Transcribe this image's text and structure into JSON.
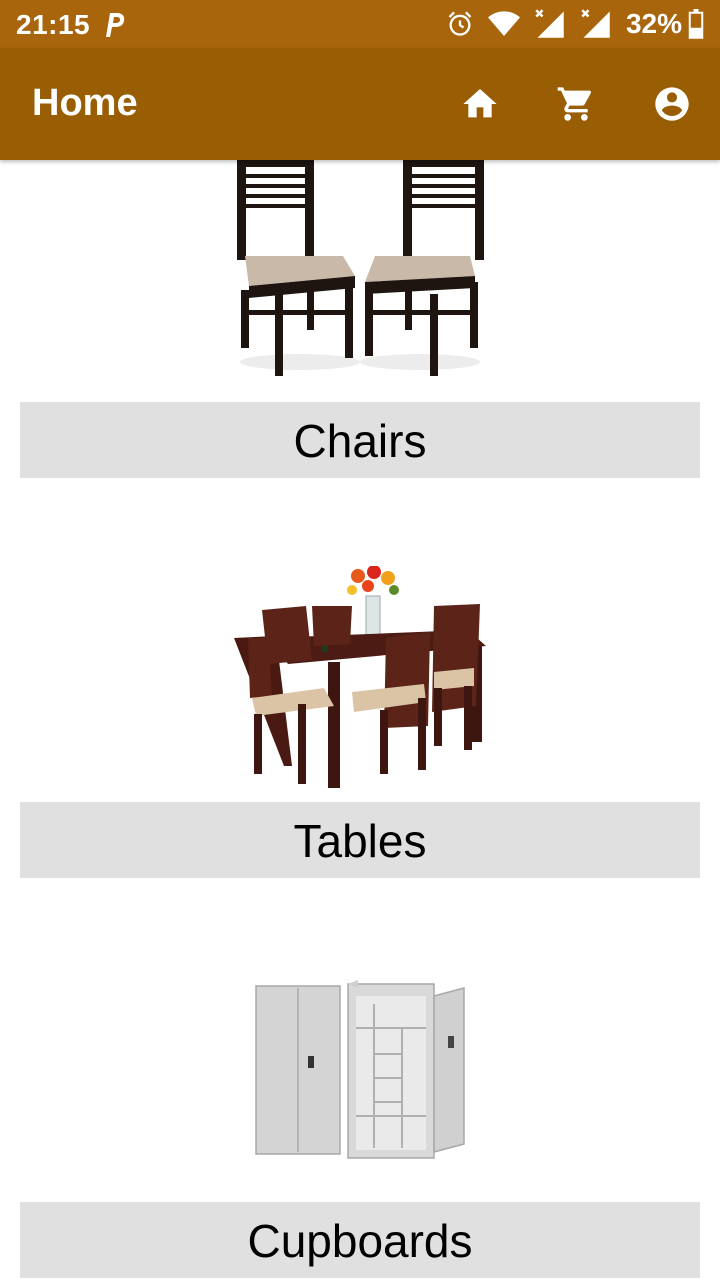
{
  "status_bar": {
    "time": "21:15",
    "battery": "32%",
    "icons": [
      "parking-icon",
      "alarm-icon",
      "wifi-icon",
      "signal-icon",
      "signal-icon",
      "battery-icon"
    ]
  },
  "app_bar": {
    "title": "Home",
    "icons": [
      "home-icon",
      "cart-icon",
      "account-icon"
    ],
    "color": "#995d03"
  },
  "categories": [
    {
      "label": "Chairs"
    },
    {
      "label": "Tables"
    },
    {
      "label": "Cupboards"
    }
  ]
}
